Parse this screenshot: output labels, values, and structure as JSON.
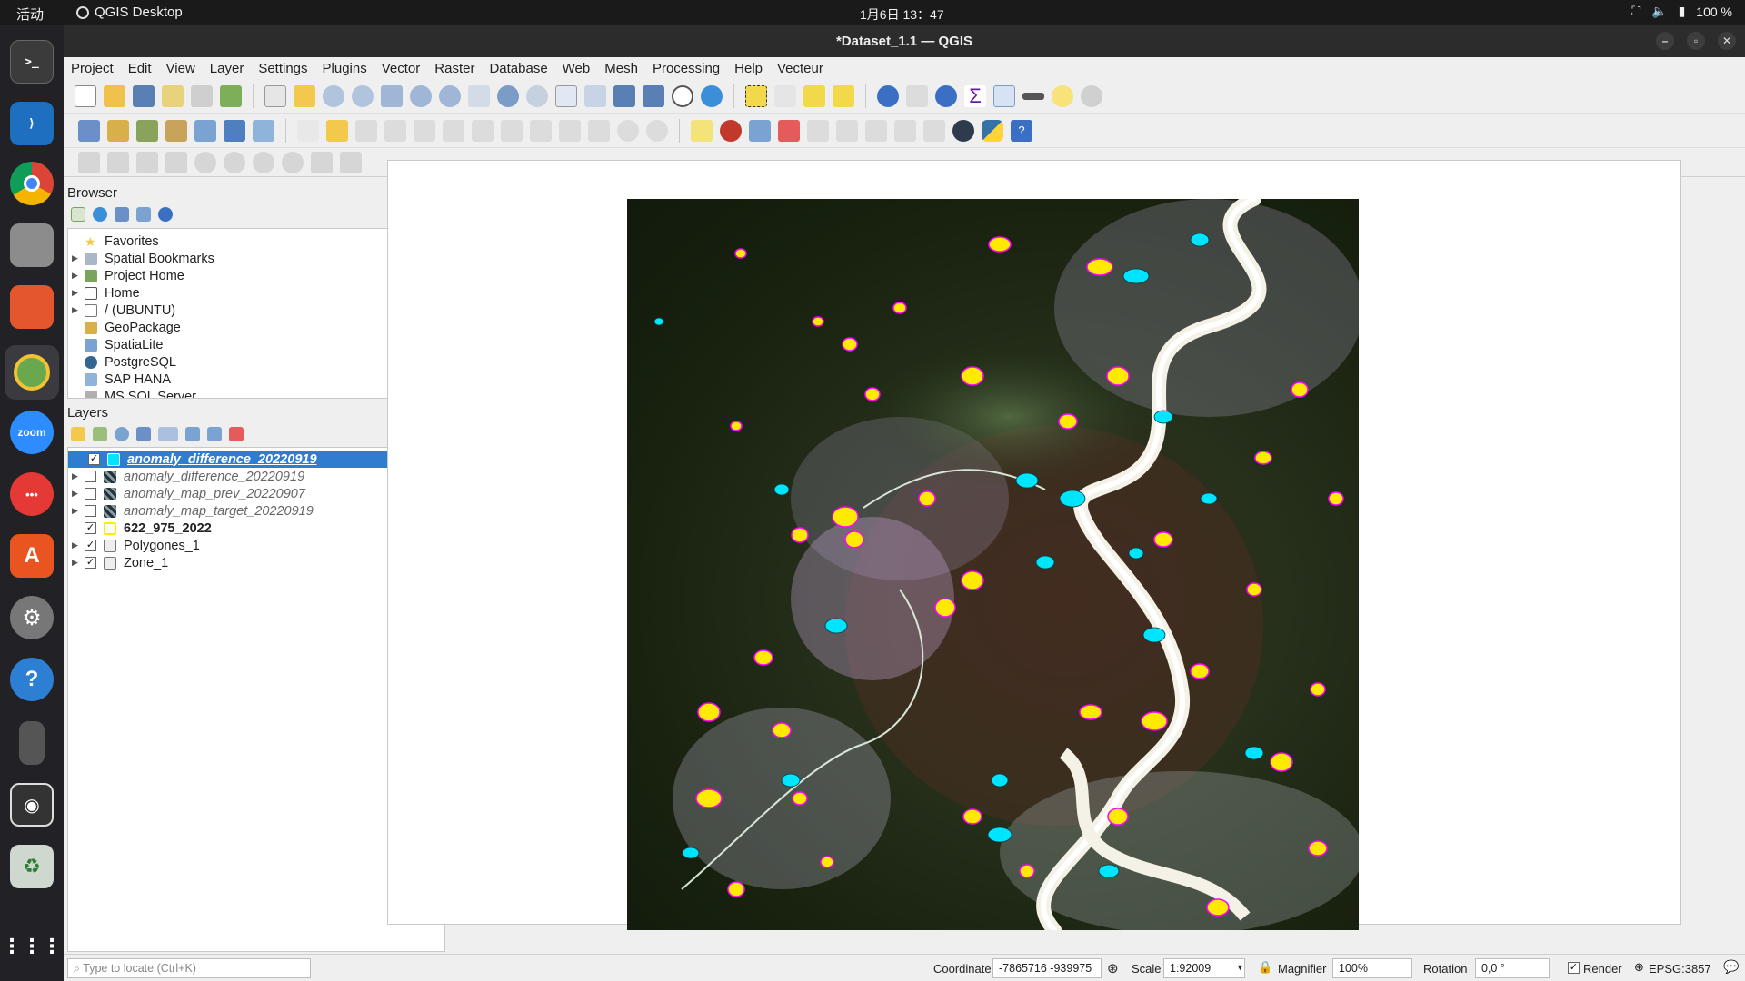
{
  "system": {
    "activities": "活动",
    "app_name": "QGIS Desktop",
    "clock": "1月6日 13：47",
    "battery": "100 %"
  },
  "window": {
    "title": "*Dataset_1.1 — QGIS"
  },
  "menu": [
    "Project",
    "Edit",
    "View",
    "Layer",
    "Settings",
    "Plugins",
    "Vector",
    "Raster",
    "Database",
    "Web",
    "Mesh",
    "Processing",
    "Help",
    "Vecteur"
  ],
  "browser": {
    "title": "Browser",
    "items": [
      "Favorites",
      "Spatial Bookmarks",
      "Project Home",
      "Home",
      "/ (UBUNTU)",
      "GeoPackage",
      "SpatiaLite",
      "PostgreSQL",
      "SAP HANA",
      "MS SQL Server"
    ]
  },
  "layers": {
    "title": "Layers",
    "items": [
      {
        "name": "anomaly_difference_20220919",
        "checked": true,
        "selected": true
      },
      {
        "name": "anomaly_difference_20220919",
        "checked": false
      },
      {
        "name": "anomaly_map_prev_20220907",
        "checked": false
      },
      {
        "name": "anomaly_map_target_20220919",
        "checked": false
      },
      {
        "name": "622_975_2022",
        "checked": true
      },
      {
        "name": "Polygones_1",
        "checked": true
      },
      {
        "name": "Zone_1",
        "checked": true
      }
    ]
  },
  "status": {
    "locate_placeholder": "Type to locate (Ctrl+K)",
    "coordinate_label": "Coordinate",
    "coordinate_value": "-7865716 -939975",
    "scale_label": "Scale",
    "scale_value": "1:92009",
    "magnifier_label": "Magnifier",
    "magnifier_value": "100%",
    "rotation_label": "Rotation",
    "rotation_value": "0,0 °",
    "render_label": "Render",
    "crs": "EPSG:3857"
  },
  "colors": {
    "selection": "#2f7dd1",
    "anomaly_yellow": "#ffea00",
    "anomaly_cyan": "#00e5ff",
    "map_bg": "#1b2612"
  }
}
